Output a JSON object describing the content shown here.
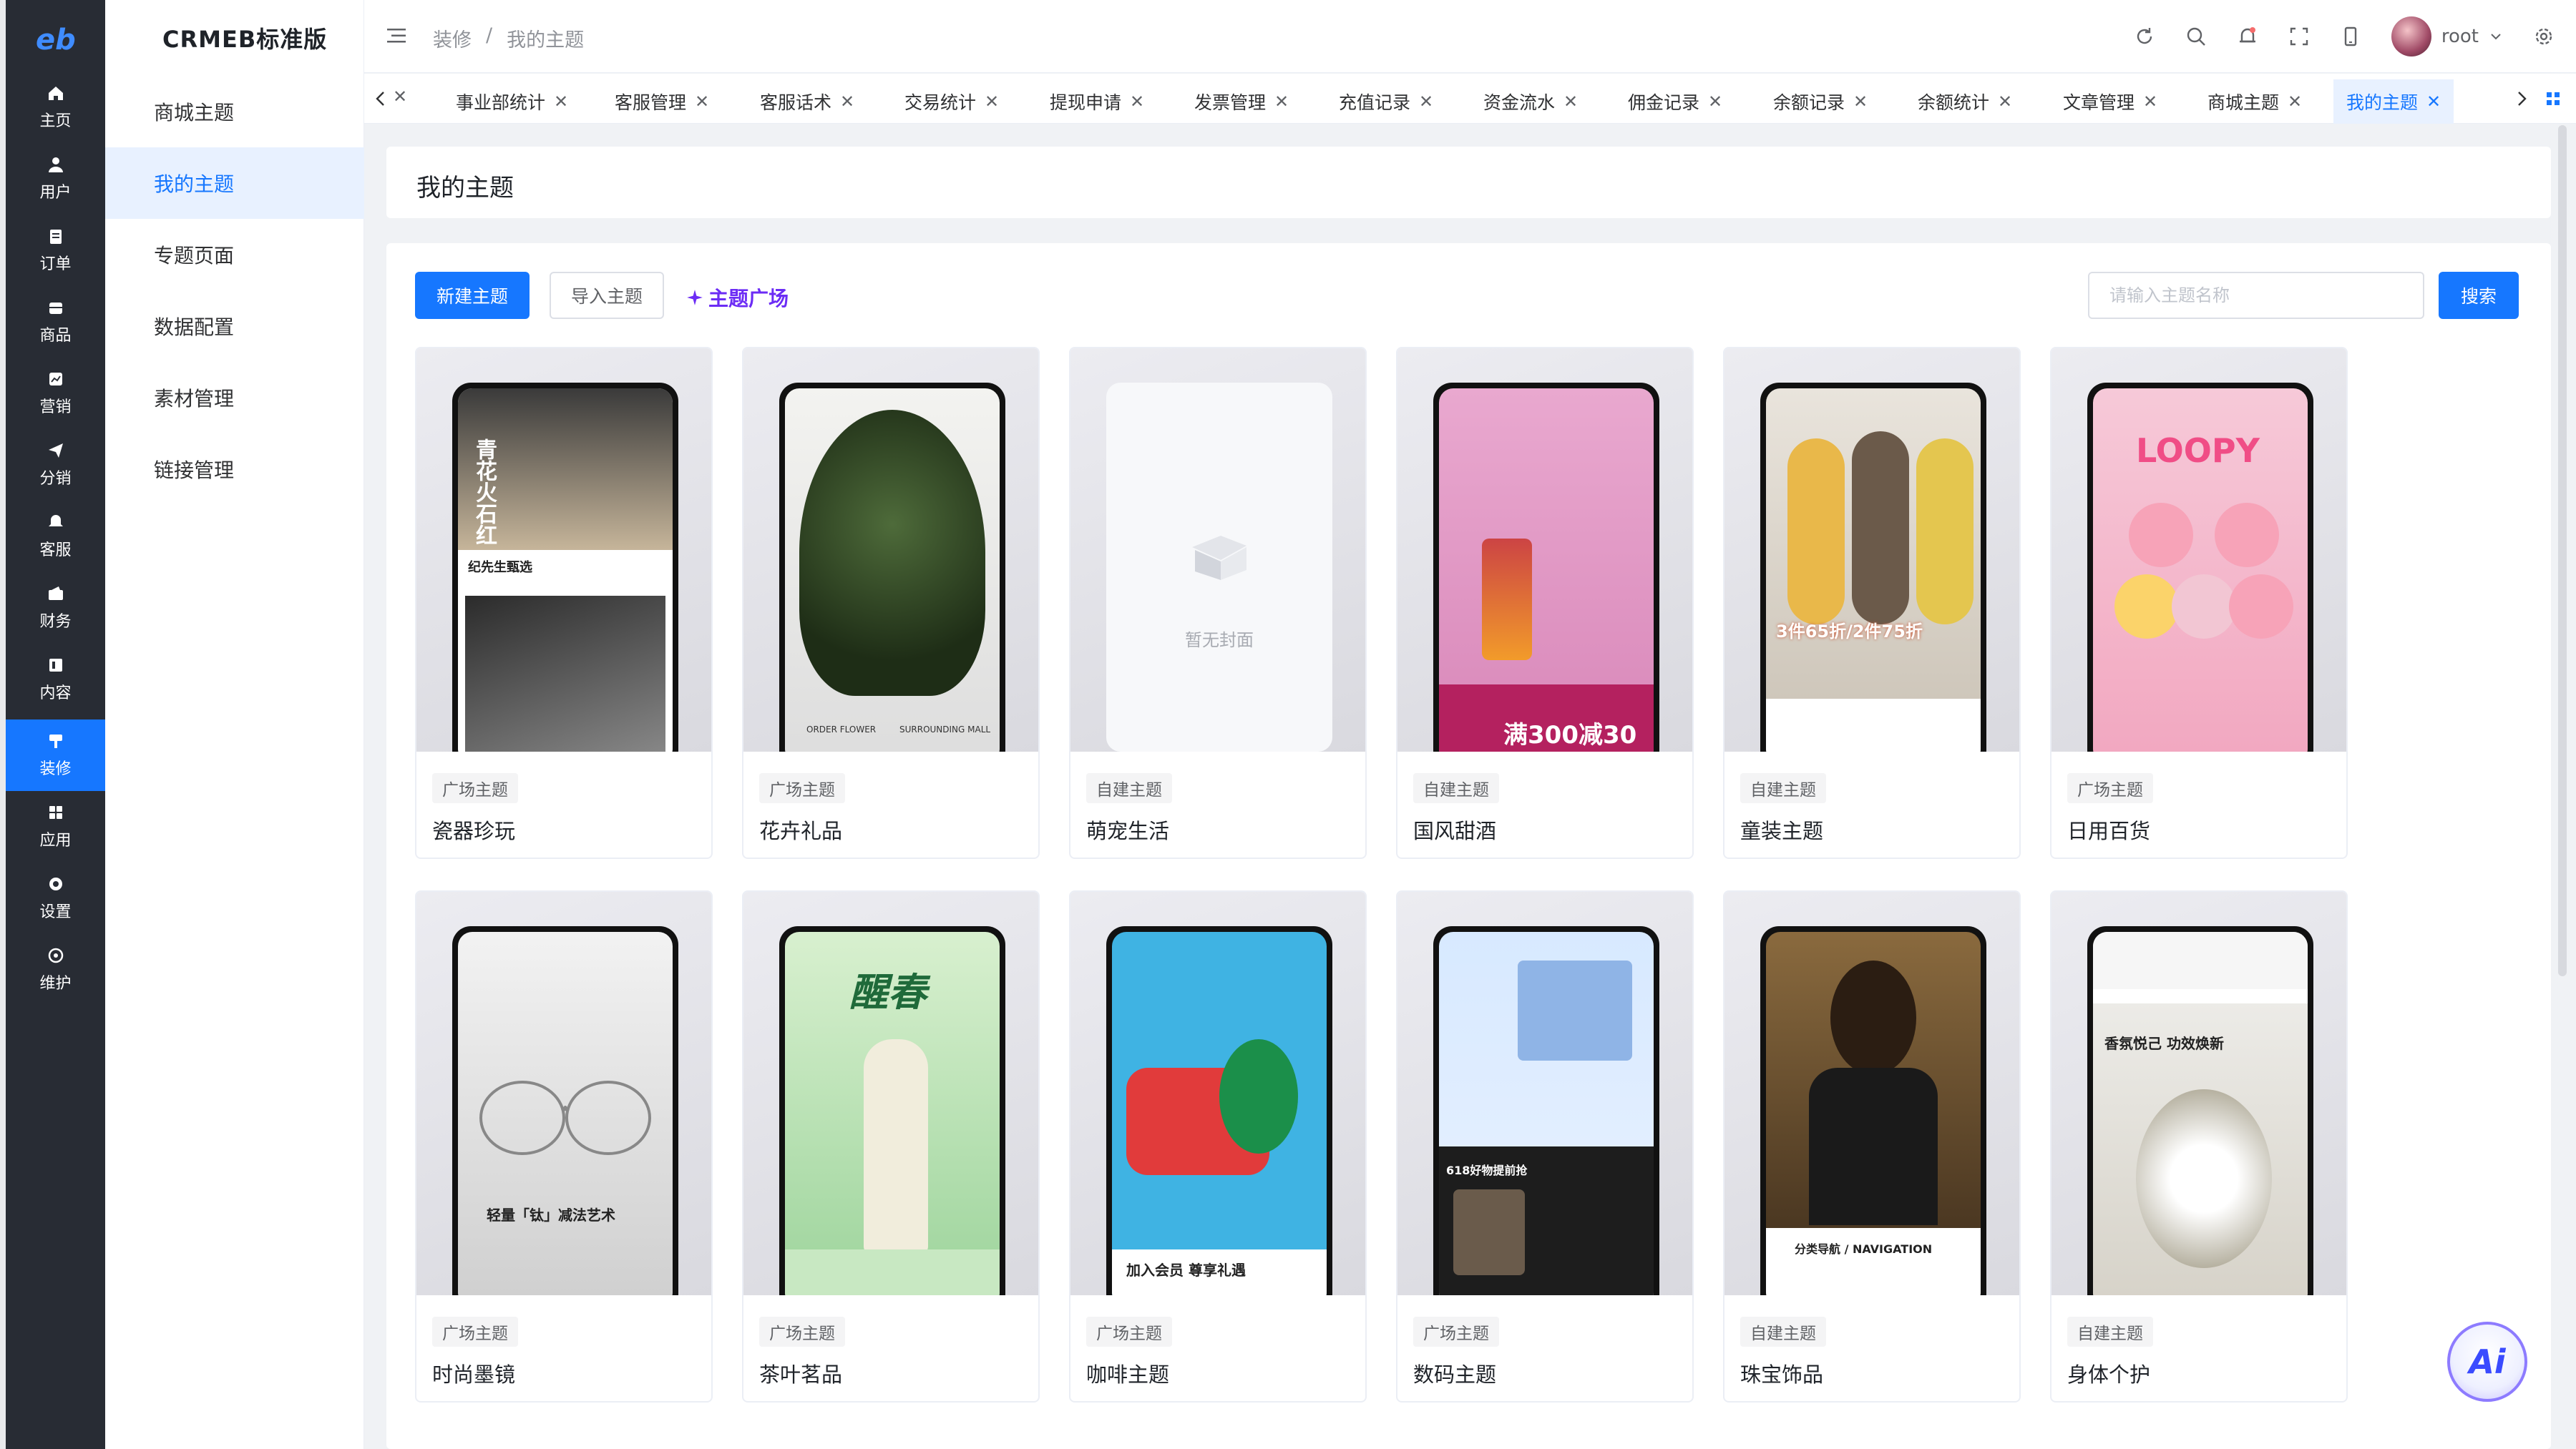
{
  "app": {
    "logo_text": "eb",
    "brand": "CRMEB标准版"
  },
  "rail": [
    {
      "label": "主页",
      "icon": "home-icon"
    },
    {
      "label": "用户",
      "icon": "user-icon"
    },
    {
      "label": "订单",
      "icon": "order-icon"
    },
    {
      "label": "商品",
      "icon": "product-icon"
    },
    {
      "label": "营销",
      "icon": "marketing-icon"
    },
    {
      "label": "分销",
      "icon": "distribution-icon"
    },
    {
      "label": "客服",
      "icon": "service-icon"
    },
    {
      "label": "财务",
      "icon": "finance-icon"
    },
    {
      "label": "内容",
      "icon": "content-icon"
    },
    {
      "label": "装修",
      "icon": "decoration-icon"
    },
    {
      "label": "应用",
      "icon": "apps-icon"
    },
    {
      "label": "设置",
      "icon": "settings-icon"
    },
    {
      "label": "维护",
      "icon": "maintenance-icon"
    }
  ],
  "submenu": [
    "商城主题",
    "我的主题",
    "专题页面",
    "数据配置",
    "素材管理",
    "链接管理"
  ],
  "breadcrumb": {
    "parent": "装修",
    "separator": "/",
    "current": "我的主题"
  },
  "header": {
    "username": "root"
  },
  "tabs": [
    "事业部统计",
    "客服管理",
    "客服话术",
    "交易统计",
    "提现申请",
    "发票管理",
    "充值记录",
    "资金流水",
    "佣金记录",
    "余额记录",
    "余额统计",
    "文章管理",
    "商城主题",
    "我的主题"
  ],
  "page_title": "我的主题",
  "toolbar": {
    "new_label": "新建主题",
    "import_label": "导入主题",
    "plaza_label": "主题广场",
    "search_placeholder": "请输入主题名称",
    "search_label": "搜索"
  },
  "themes": [
    {
      "tag": "广场主题",
      "name": "瓷器珍玩",
      "cover_text": "纪先生甄选",
      "cover_title": "青花火石红"
    },
    {
      "tag": "广场主题",
      "name": "花卉礼品",
      "cover_text": "ORDER FLOWER",
      "cover_text2": "SURROUNDING MALL"
    },
    {
      "tag": "自建主题",
      "name": "萌宠生活",
      "empty_text": "暂无封面"
    },
    {
      "tag": "自建主题",
      "name": "国风甜酒",
      "cover_text": "满300减30"
    },
    {
      "tag": "自建主题",
      "name": "童装主题",
      "cover_text": "3件65折/2件75折"
    },
    {
      "tag": "广场主题",
      "name": "日用百货",
      "cover_text": "LOOPY"
    },
    {
      "tag": "广场主题",
      "name": "时尚墨镜",
      "cover_text": "轻量「钛」减法艺术"
    },
    {
      "tag": "广场主题",
      "name": "茶叶茗品",
      "cover_text": "醒春"
    },
    {
      "tag": "广场主题",
      "name": "咖啡主题",
      "cover_text": "加入会员 尊享礼遇"
    },
    {
      "tag": "广场主题",
      "name": "数码主题",
      "cover_text": "618好物提前抢"
    },
    {
      "tag": "自建主题",
      "name": "珠宝饰品",
      "cover_text": "分类导航 / NAVIGATION"
    },
    {
      "tag": "自建主题",
      "name": "身体个护",
      "cover_text": "香氛悦己 功效焕新"
    }
  ],
  "ai_label": "Ai",
  "colors": {
    "primary": "#1677ff",
    "rail": "#282c34",
    "plaza": "#6c2cf5"
  }
}
